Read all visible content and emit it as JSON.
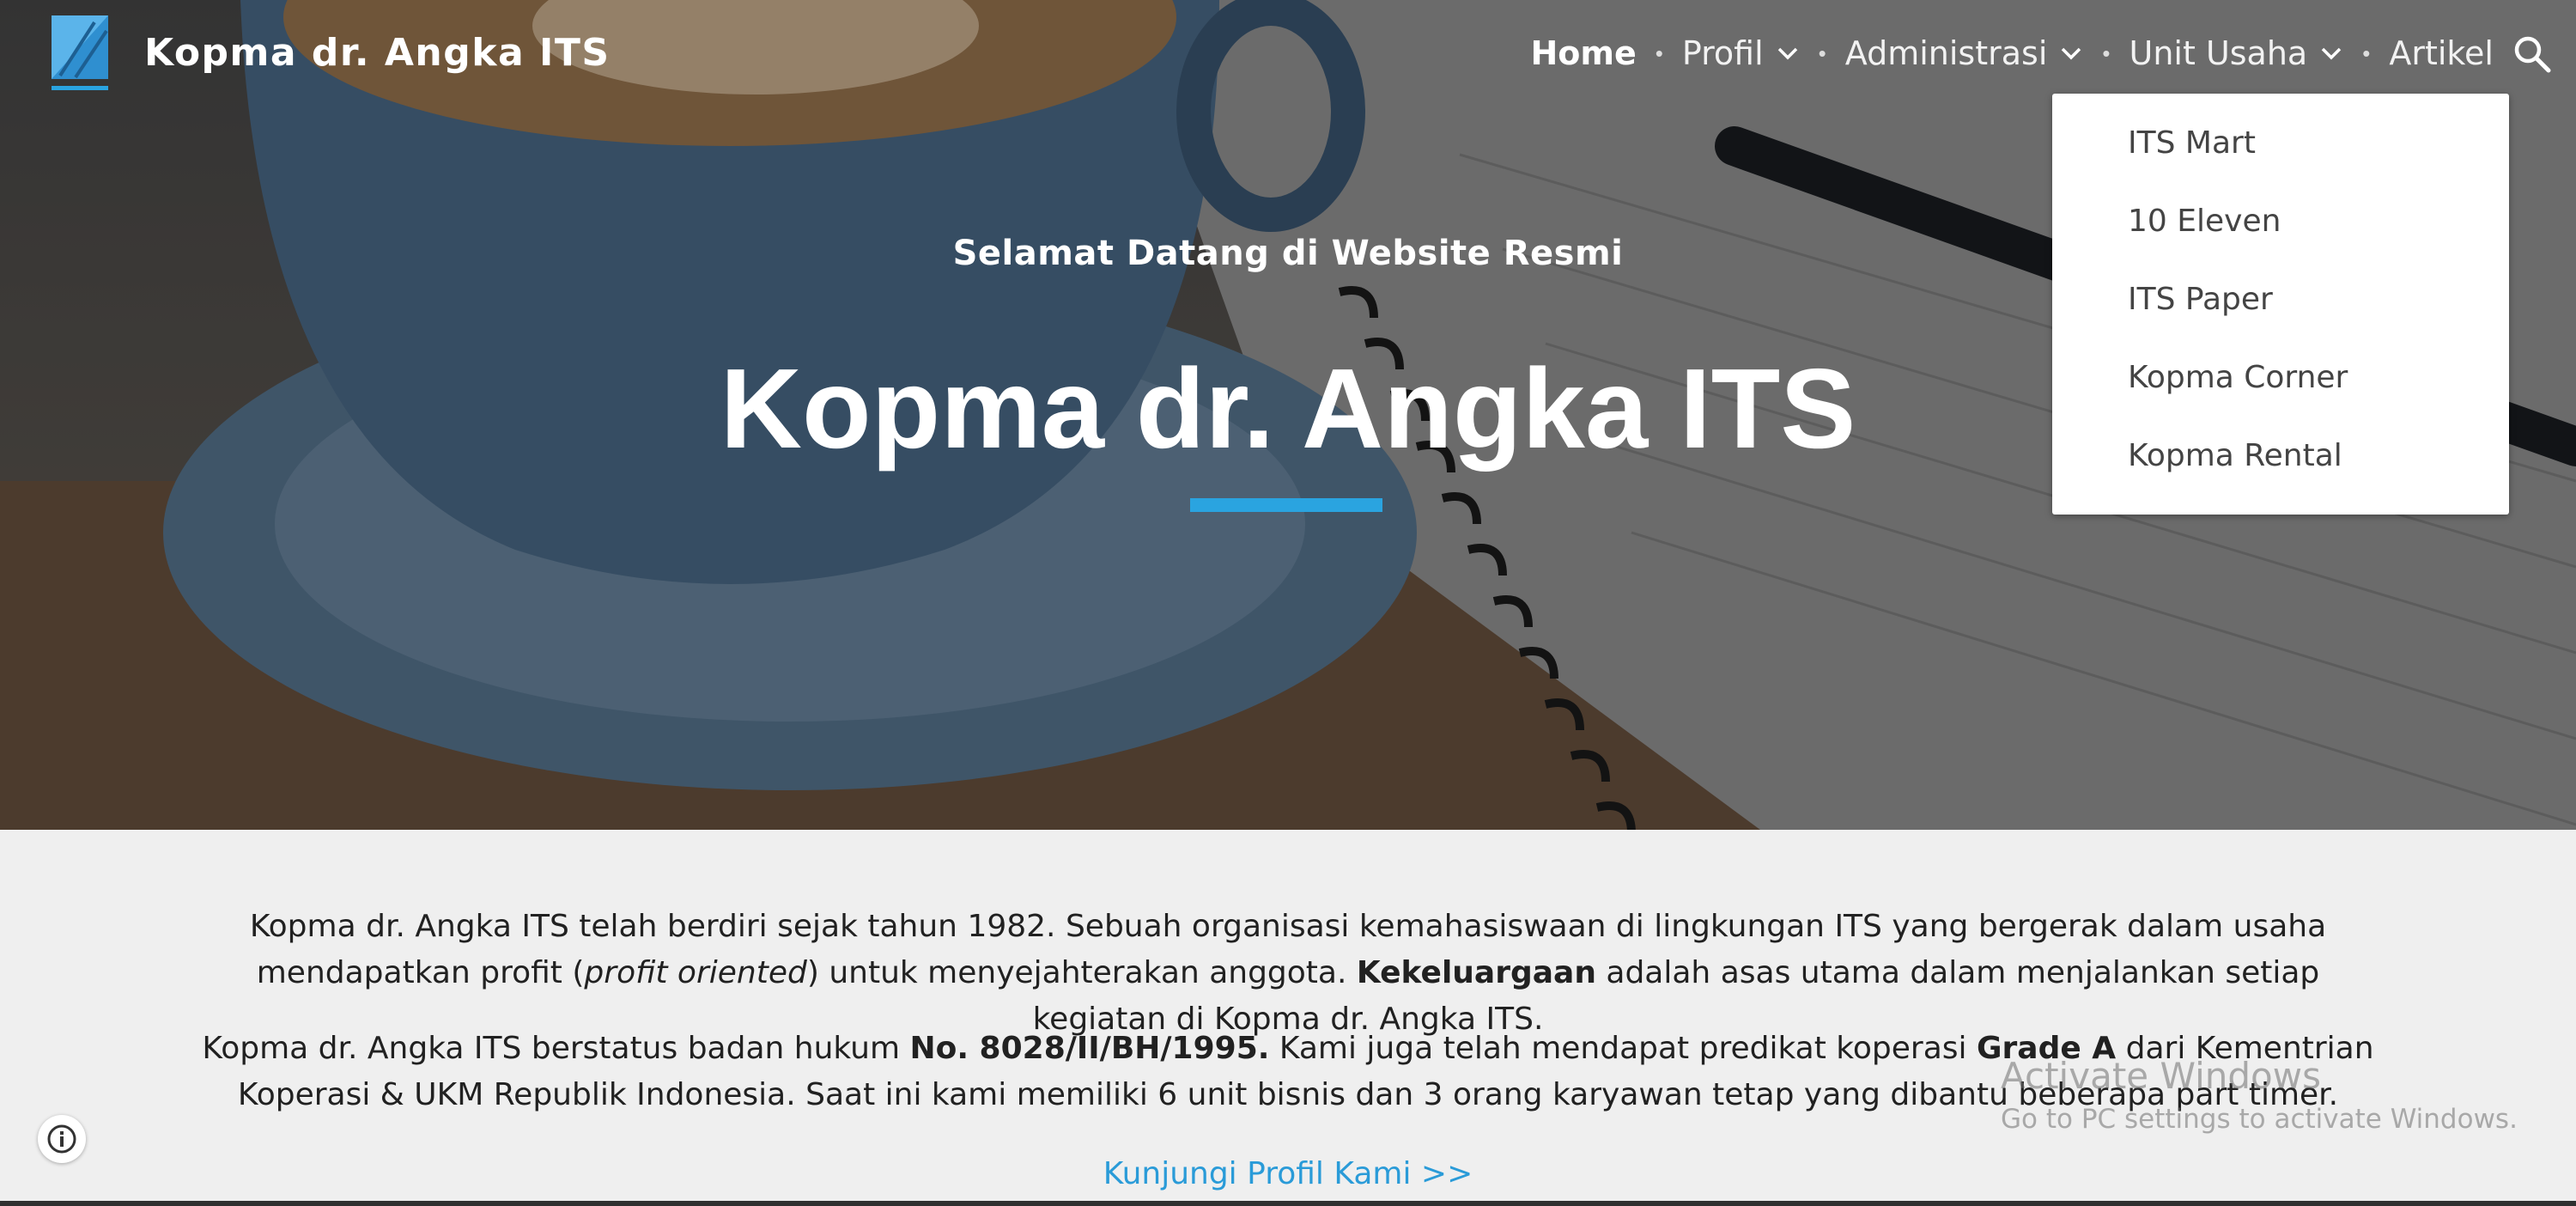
{
  "brand": {
    "site_name": "Kopma dr. Angka ITS",
    "accent_color": "#2aa4e0"
  },
  "nav": {
    "items": [
      {
        "label": "Home",
        "active": true,
        "has_dropdown": false
      },
      {
        "label": "Profil",
        "active": false,
        "has_dropdown": true
      },
      {
        "label": "Administrasi",
        "active": false,
        "has_dropdown": true
      },
      {
        "label": "Unit Usaha",
        "active": false,
        "has_dropdown": true
      },
      {
        "label": "Artikel",
        "active": false,
        "has_dropdown": false
      }
    ],
    "search_icon": "search-icon"
  },
  "dropdown": {
    "parent": "Unit Usaha",
    "items": [
      "ITS Mart",
      "10 Eleven",
      "ITS Paper",
      "Kopma Corner",
      "Kopma Rental"
    ]
  },
  "hero": {
    "subtitle": "Selamat Datang di Website Resmi",
    "title": "Kopma dr. Angka ITS"
  },
  "content": {
    "p1": {
      "a": "Kopma dr. Angka ITS telah berdiri sejak tahun 1982. Sebuah organisasi kemahasiswaan di lingkungan ITS yang bergerak dalam usaha mendapatkan profit (",
      "b": "profit oriented",
      "c": ") untuk menyejahterakan anggota. ",
      "d": "Kekeluargaan",
      "e": " adalah asas utama dalam menjalankan setiap kegiatan di Kopma dr.  Angka ITS."
    },
    "p2": {
      "a": "Kopma dr. Angka ITS  berstatus badan hukum ",
      "b": "No. 8028/II/BH/1995.",
      "c": " Kami juga telah mendapat predikat koperasi ",
      "d": "Grade A",
      "e": " dari Kementrian Koperasi & UKM Republik Indonesia. Saat ini kami memiliki 6 unit bisnis dan 3 orang karyawan tetap yang dibantu beberapa part timer."
    },
    "cta": "Kunjungi Profil Kami >>"
  },
  "watermark": {
    "line1": "Activate Windows",
    "line2": "Go to PC settings to activate Windows."
  },
  "info_icon": "info-icon"
}
